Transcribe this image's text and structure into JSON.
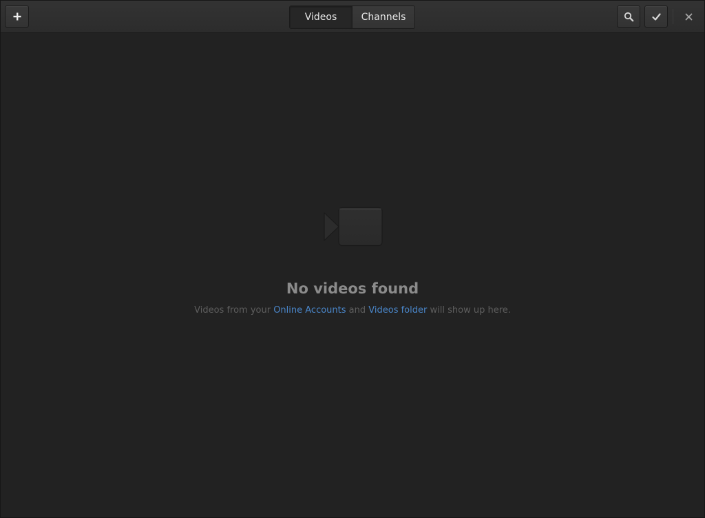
{
  "headerbar": {
    "new_button_icon": "plus-icon",
    "tabs": [
      {
        "label": "Videos",
        "active": true
      },
      {
        "label": "Channels",
        "active": false
      }
    ],
    "search_button_icon": "search-icon",
    "select_button_icon": "checkmark-icon",
    "close_button_icon": "close-icon"
  },
  "empty_state": {
    "icon": "video-camera-icon",
    "title": "No videos found",
    "subtitle_prefix": "Videos from your",
    "link_online_accounts": "Online Accounts",
    "subtitle_and": "and",
    "link_videos_folder": "Videos folder",
    "subtitle_suffix": "will show up here."
  },
  "colors": {
    "background": "#222222",
    "headerbar": "#2f2f2f",
    "link": "#4a86c9",
    "title_text": "#8b8b8b",
    "subtitle_text": "#5e5e5e"
  }
}
